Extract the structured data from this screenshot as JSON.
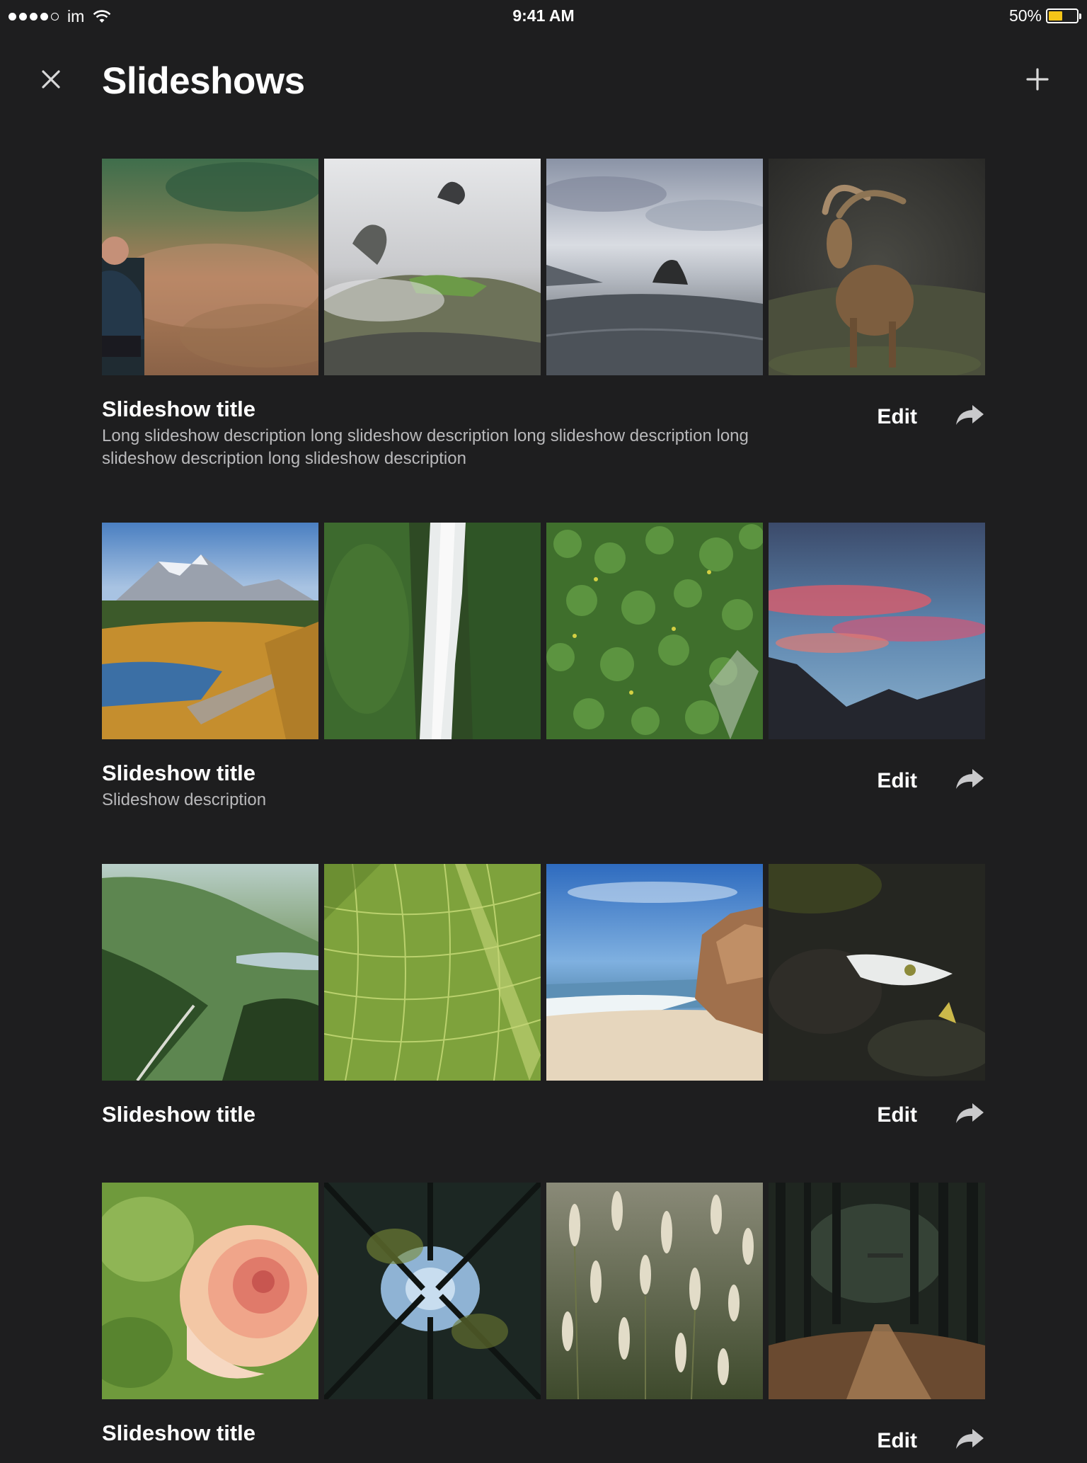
{
  "status_bar": {
    "carrier": "im",
    "time": "9:41 AM",
    "battery": "50%",
    "battery_level": 0.5,
    "battery_color": "#f5c518",
    "signal_bars": 4
  },
  "header": {
    "title": "Slideshows",
    "close_icon": "close-icon",
    "add_icon": "plus-icon"
  },
  "slideshows": [
    {
      "title": "Slideshow title",
      "description": "Long slideshow description long slideshow description long slideshow description long slideshow description long slideshow description",
      "edit_label": "Edit",
      "share_icon": "share-arrow-icon",
      "thumbnails": [
        "autumn-field-man",
        "misty-mountain-ruins",
        "sea-stack-beach",
        "mountain-ibex"
      ]
    },
    {
      "title": "Slideshow title",
      "description": "Slideshow description",
      "edit_label": "Edit",
      "share_icon": "share-arrow-icon",
      "thumbnails": [
        "alpine-lake-boardwalk",
        "forest-waterfall",
        "green-ground-cover",
        "sunset-clouds-mountains"
      ]
    },
    {
      "title": "Slideshow title",
      "description": "",
      "edit_label": "Edit",
      "share_icon": "share-arrow-icon",
      "thumbnails": [
        "green-valley-river",
        "leaf-veins-closeup",
        "sandy-beach-cliff",
        "white-feather-dark"
      ]
    },
    {
      "title": "Slideshow title",
      "description": "",
      "edit_label": "Edit",
      "share_icon": "share-arrow-icon",
      "thumbnails": [
        "peach-rose",
        "tree-canopy-sky",
        "wild-grass-seedheads",
        "forest-path"
      ]
    }
  ]
}
